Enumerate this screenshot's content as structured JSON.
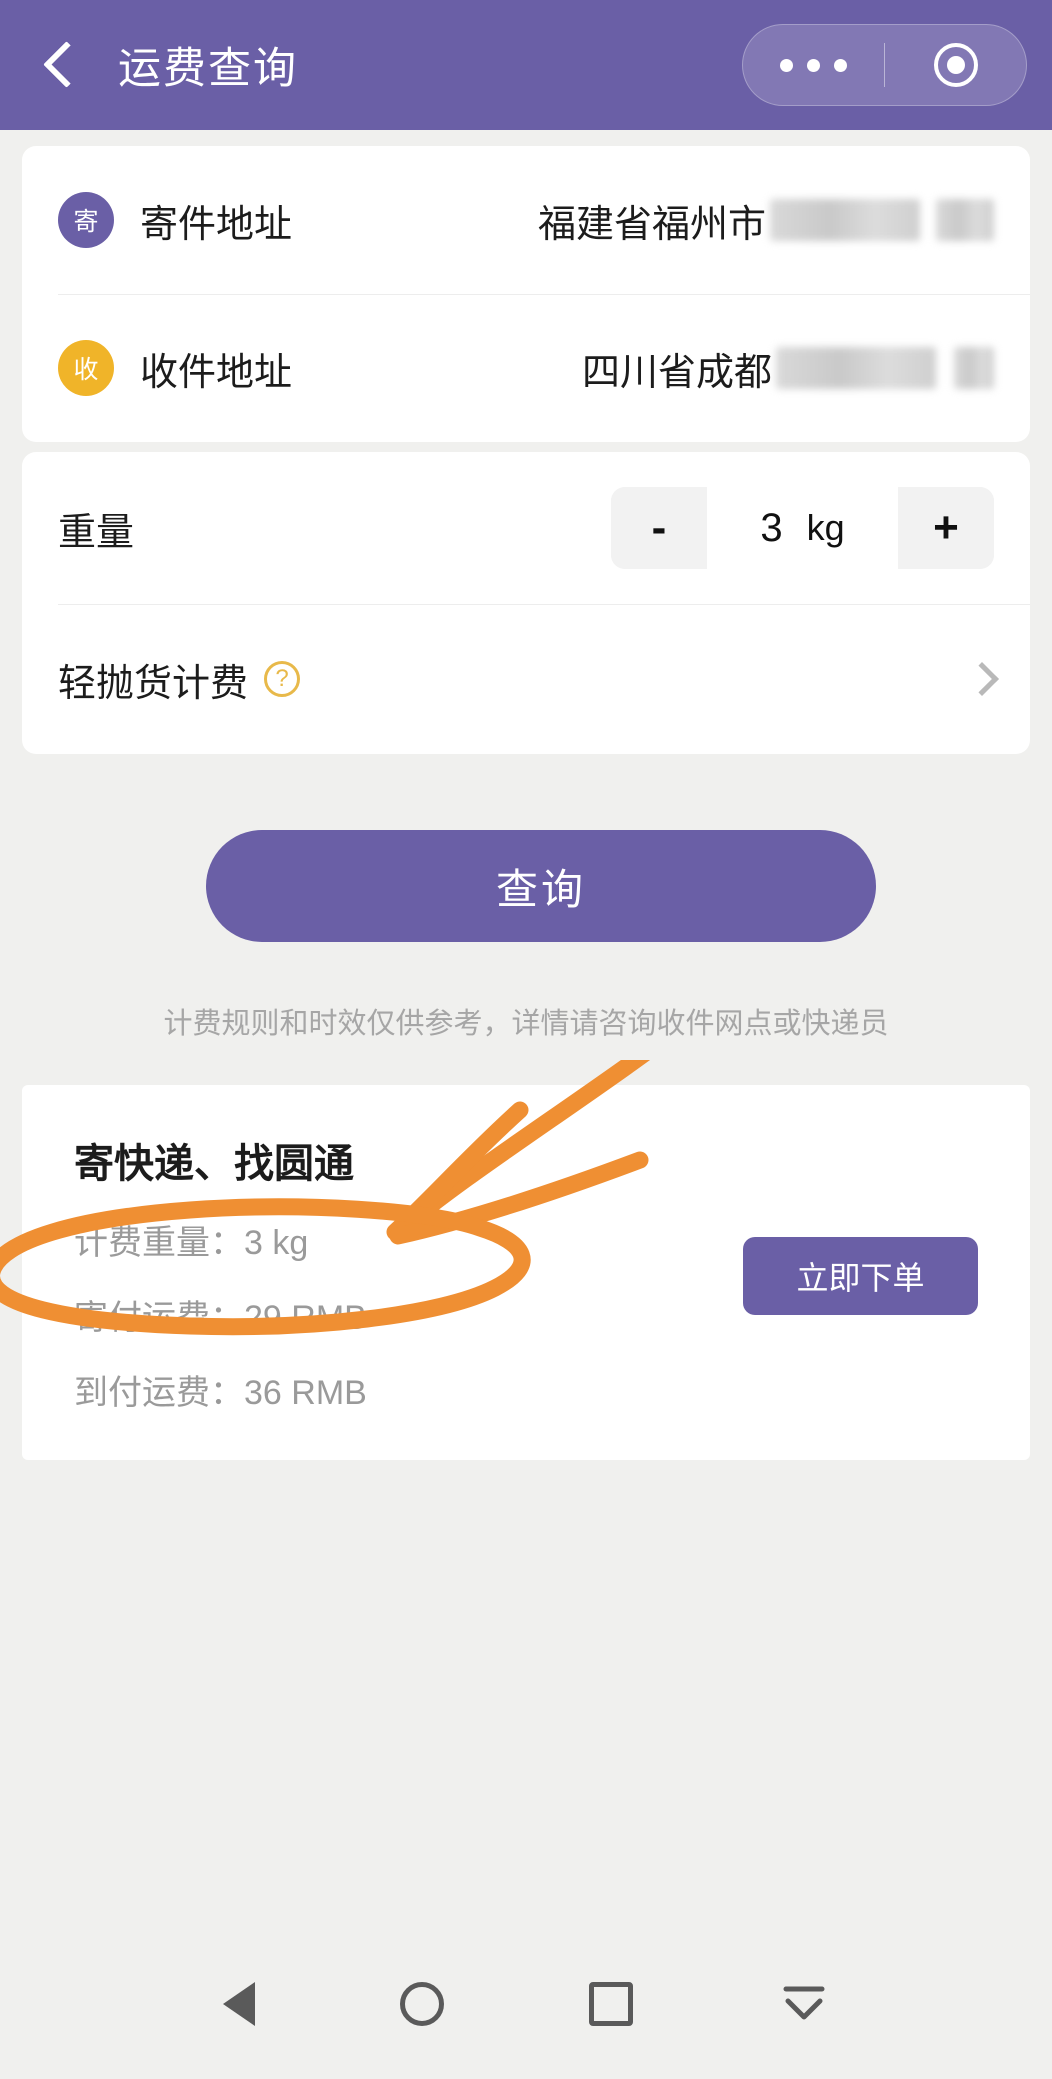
{
  "header": {
    "title": "运费查询",
    "back_icon": "back-chevron-icon",
    "capsule": {
      "more_icon": "more-dots-icon",
      "target_icon": "target-circle-icon"
    }
  },
  "address": {
    "sender": {
      "badge": "寄",
      "label": "寄件地址",
      "value": "福建省福州市"
    },
    "receiver": {
      "badge": "收",
      "label": "收件地址",
      "value": "四川省成都"
    }
  },
  "weight": {
    "label": "重量",
    "minus": "-",
    "value": "3",
    "unit": "kg",
    "plus": "+"
  },
  "light_goods": {
    "label": "轻抛货计费",
    "help_icon": "question-mark-icon",
    "chevron_icon": "chevron-right-icon"
  },
  "query_button": {
    "label": "查询"
  },
  "disclaimer": {
    "text": "计费规则和时效仅供参考，详情请咨询收件网点或快递员"
  },
  "result": {
    "title": "寄快递、找圆通",
    "billing_weight": "计费重量：3 kg",
    "prepaid_fee": "寄付运费：29 RMB",
    "collect_fee": "到付运费：36 RMB",
    "order_button": "立即下单"
  },
  "navbar": {
    "back_icon": "nav-back-triangle-icon",
    "home_icon": "nav-home-circle-icon",
    "recents_icon": "nav-recents-square-icon",
    "hide_icon": "nav-hide-keyboard-icon"
  },
  "colors": {
    "brand_purple": "#6a5fa6",
    "accent_amber": "#f0b429",
    "annotation_orange": "#ef8f33",
    "page_background": "#f0f0ee"
  }
}
